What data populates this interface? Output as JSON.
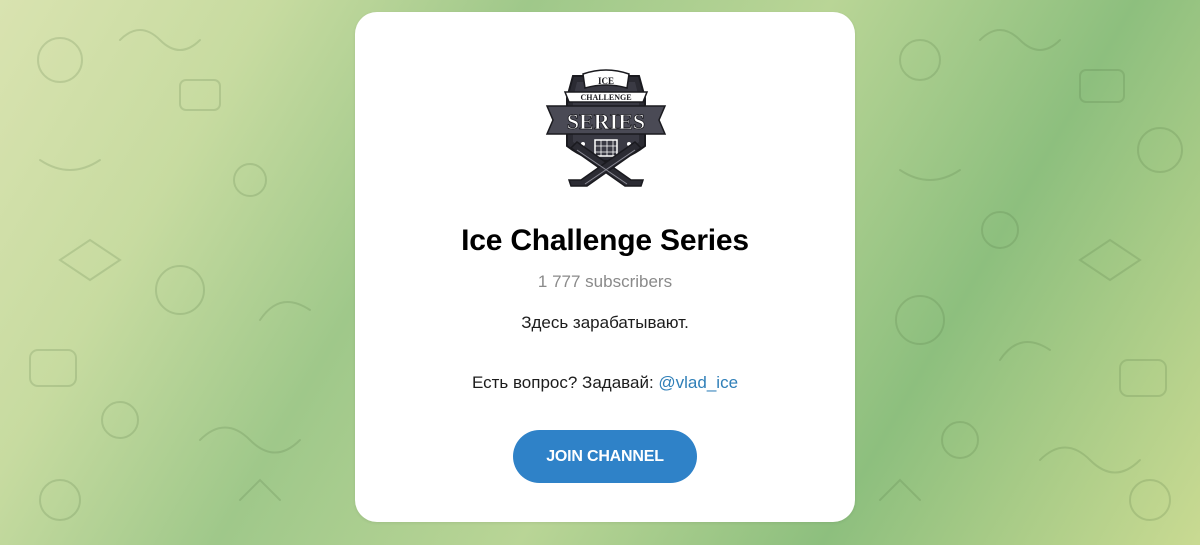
{
  "channel": {
    "title": "Ice Challenge Series",
    "subscribers": "1 777 subscribers",
    "description_line1": "Здесь зарабатывают.",
    "description_prefix": "Есть вопрос? Задавай: ",
    "contact_link": "@vlad_ice",
    "join_label": "JOIN CHANNEL",
    "logo": {
      "icon": "ice-challenge-series-logo",
      "text_top": "ICE",
      "text_middle": "CHALLENGE",
      "text_main": "SERIES"
    }
  },
  "colors": {
    "accent": "#2f82c8",
    "link": "#2f7fb8",
    "muted_text": "#8a8a8a",
    "card_bg": "#ffffff"
  }
}
